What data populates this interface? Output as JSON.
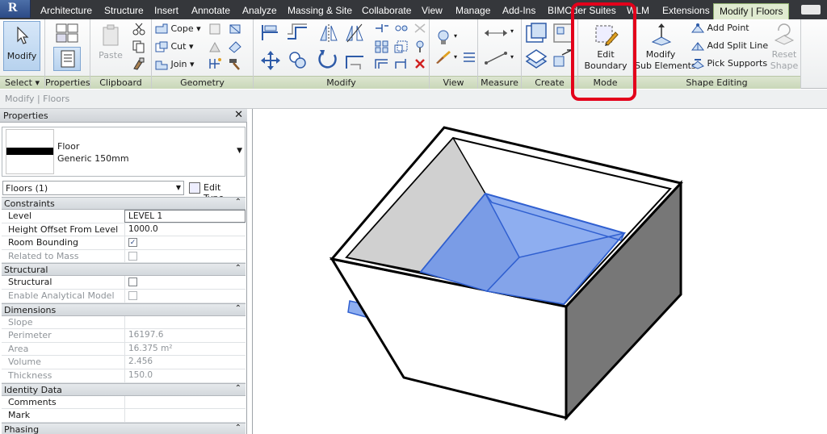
{
  "tabs": [
    {
      "label": "Architecture"
    },
    {
      "label": "Structure"
    },
    {
      "label": "Insert"
    },
    {
      "label": "Annotate"
    },
    {
      "label": "Analyze"
    },
    {
      "label": "Massing & Site"
    },
    {
      "label": "Collaborate"
    },
    {
      "label": "View"
    },
    {
      "label": "Manage"
    },
    {
      "label": "Add-Ins"
    },
    {
      "label": "BIMOder Suites"
    },
    {
      "label": "WLM"
    },
    {
      "label": "Extensions"
    },
    {
      "label": "Modify | Floors"
    }
  ],
  "ribbon": {
    "select": {
      "button": "Modify",
      "title": "Select"
    },
    "properties": {
      "title": "Properties"
    },
    "clipboard": {
      "paste": "Paste",
      "title": "Clipboard"
    },
    "geometry": {
      "cope": "Cope",
      "cut": "Cut",
      "join": "Join",
      "title": "Geometry"
    },
    "modify": {
      "title": "Modify"
    },
    "view": {
      "title": "View"
    },
    "measure": {
      "title": "Measure"
    },
    "create": {
      "title": "Create"
    },
    "mode": {
      "button_line1": "Edit",
      "button_line2": "Boundary",
      "title": "Mode"
    },
    "shape_editing": {
      "modify_sub_line1": "Modify",
      "modify_sub_line2": "Sub Elements",
      "add_point": "Add Point",
      "add_split_line": "Add Split Line",
      "pick_supports": "Pick Supports",
      "reset_line1": "Reset",
      "reset_line2": "Shape",
      "title": "Shape Editing"
    }
  },
  "options_bar": {
    "text": "Modify | Floors"
  },
  "properties": {
    "header": "Properties",
    "type_name": "Floor",
    "type_sub": "Generic 150mm",
    "instance_select": "Floors (1)",
    "edit_type": "Edit Type",
    "groups": [
      {
        "title": "Constraints",
        "rows": [
          {
            "key": "Level",
            "value": "LEVEL 1"
          },
          {
            "key": "Height Offset From Level",
            "value": "1000.0"
          },
          {
            "key": "Room Bounding",
            "value": "✓"
          },
          {
            "key": "Related to Mass",
            "value": ""
          }
        ]
      },
      {
        "title": "Structural",
        "rows": [
          {
            "key": "Structural",
            "value": ""
          },
          {
            "key": "Enable Analytical Model",
            "value": ""
          }
        ]
      },
      {
        "title": "Dimensions",
        "rows": [
          {
            "key": "Slope",
            "value": ""
          },
          {
            "key": "Perimeter",
            "value": "16197.6"
          },
          {
            "key": "Area",
            "value": "16.375 m²"
          },
          {
            "key": "Volume",
            "value": "2.456"
          },
          {
            "key": "Thickness",
            "value": "150.0"
          }
        ]
      },
      {
        "title": "Identity Data",
        "rows": [
          {
            "key": "Comments",
            "value": ""
          },
          {
            "key": "Mark",
            "value": ""
          }
        ]
      },
      {
        "title": "Phasing",
        "rows": []
      }
    ]
  },
  "colors": {
    "highlight": "#e3001b",
    "selected_floor": "#8eaef0",
    "ribbon_title": "#c9d7b8"
  }
}
